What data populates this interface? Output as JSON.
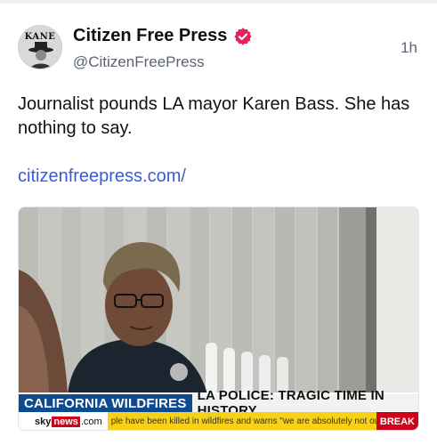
{
  "tweet": {
    "display_name": "Citizen Free Press",
    "handle": "@CitizenFreePress",
    "time": "1h",
    "avatar_text": "KANE",
    "text": "Journalist pounds LA mayor Karen Bass. She has nothing to say.",
    "link": "citizenfreepress.com/",
    "verified_icon": "verified-badge-icon",
    "verified_color": "#e0245e"
  },
  "media": {
    "chyron_topic": "CALIFORNIA WILDFIRES",
    "chyron_headline": "LA POLICE: TRAGIC TIME IN HISTORY",
    "network_sky": "sky",
    "network_news": "news",
    "network_com": ".com",
    "ticker_text": "ple have been killed in wildfires and warns \"we are absolutely not out of danger\"",
    "ticker_breaking": "BREAK",
    "colors": {
      "chyron_blue": "#0d4a8f",
      "ticker_yellow": "#f7d117",
      "sky_red": "#d0021b"
    }
  }
}
